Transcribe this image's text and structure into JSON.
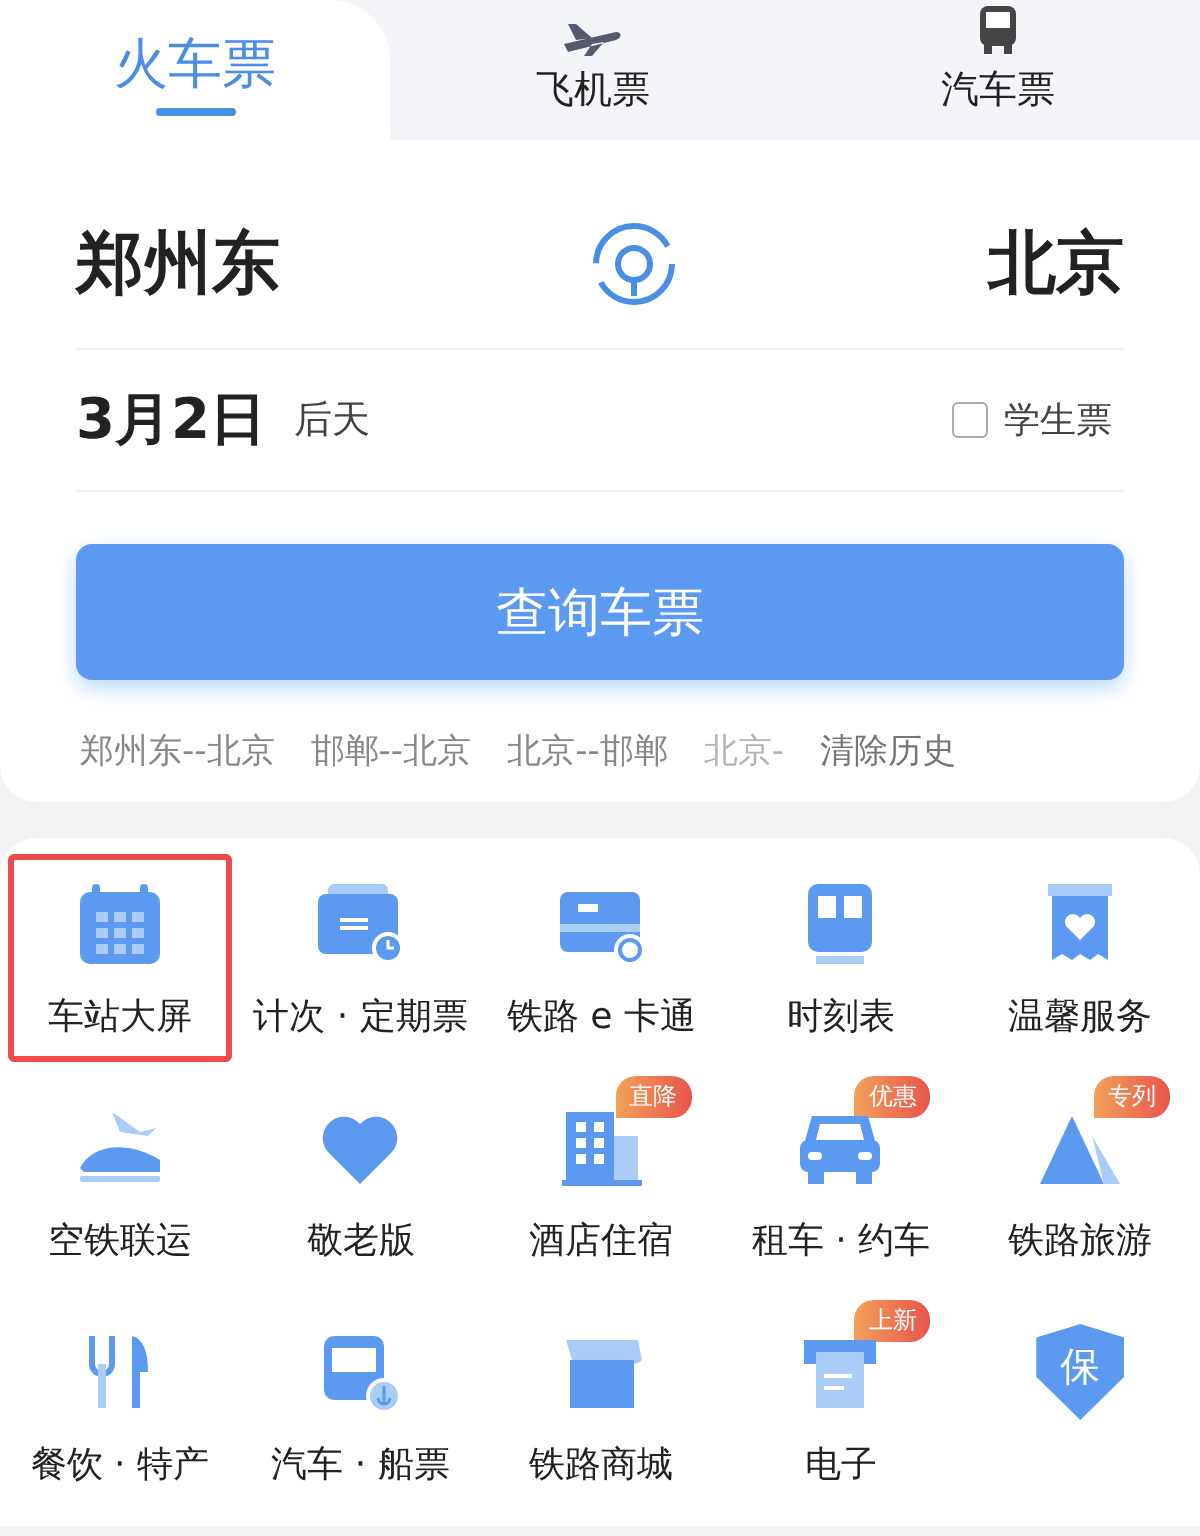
{
  "tabs": [
    {
      "label": "火车票",
      "selected": true
    },
    {
      "label": "飞机票",
      "selected": false
    },
    {
      "label": "汽车票",
      "selected": false
    }
  ],
  "route": {
    "from": "郑州东",
    "to": "北京"
  },
  "date": {
    "value": "3月2日",
    "relative": "后天"
  },
  "student_ticket": {
    "label": "学生票",
    "checked": false
  },
  "search_button": "查询车票",
  "history": [
    {
      "text": "郑州东--北京",
      "faded": false
    },
    {
      "text": "邯郸--北京",
      "faded": false
    },
    {
      "text": "北京--邯郸",
      "faded": false
    },
    {
      "text": "北京-",
      "faded": true
    }
  ],
  "clear_history": "清除历史",
  "services": [
    {
      "label": "车站大屏",
      "highlighted": true
    },
    {
      "label": "计次 · 定期票",
      "highlighted": false
    },
    {
      "label": "铁路 e 卡通",
      "highlighted": false
    },
    {
      "label": "时刻表",
      "highlighted": false
    },
    {
      "label": "温馨服务",
      "highlighted": false
    },
    {
      "label": "空铁联运",
      "highlighted": false
    },
    {
      "label": "敬老版",
      "highlighted": false
    },
    {
      "label": "酒店住宿",
      "highlighted": false,
      "badge": "直降"
    },
    {
      "label": "租车 · 约车",
      "highlighted": false,
      "badge": "优惠"
    },
    {
      "label": "铁路旅游",
      "highlighted": false,
      "badge": "专列"
    },
    {
      "label": "餐饮 · 特产",
      "highlighted": false
    },
    {
      "label": "汽车 · 船票",
      "highlighted": false
    },
    {
      "label": "铁路商城",
      "highlighted": false
    },
    {
      "label": "电子",
      "highlighted": false,
      "badge": "上新"
    },
    {
      "highlighted": false,
      "icon_text": "保"
    }
  ]
}
